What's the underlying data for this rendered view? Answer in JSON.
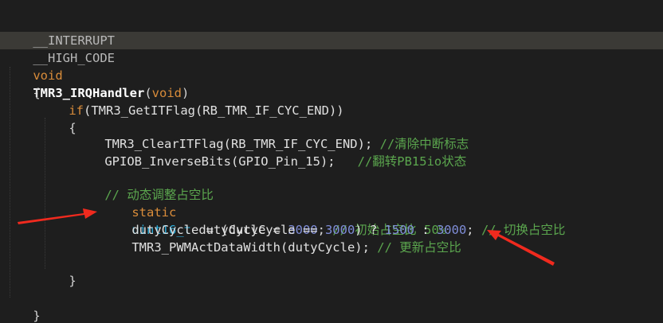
{
  "code": {
    "l1": {
      "macro": "__INTERRUPT"
    },
    "l2": {
      "macro": "__HIGH_CODE"
    },
    "l3": {
      "kw1": "void",
      "func": "TMR3_IRQHandler",
      "open": "(",
      "kw2": "void",
      "close": ")"
    },
    "l4": {
      "text": "{"
    },
    "l5": {
      "kw": "if",
      "rest": "(TMR3_GetITFlag(RB_TMR_IF_CYC_END))"
    },
    "l6": {
      "text": "{"
    },
    "l7": {
      "code": "TMR3_ClearITFlag(RB_TMR_IF_CYC_END); ",
      "comment": "//清除中断标志"
    },
    "l8": {
      "code": "GPIOB_InverseBits(GPIO_Pin_15);   ",
      "comment": "//翻转PB15io状态"
    },
    "l9": {
      "comment": "// 动态调整占空比"
    },
    "l10": {
      "kw": "static",
      "type": "uint16_t",
      "ident": " dutyCycle = ",
      "num": "3000",
      "semi": "; ",
      "comment": "// 初始占空比 50%"
    },
    "l11": {
      "a": "dutyCycle = (dutyCycle == ",
      "n1": "3000",
      "b": ") ? ",
      "n2": "1500",
      "c": " : ",
      "n3": "3000",
      "d": "; ",
      "comment": "// 切换占空比"
    },
    "l12": {
      "code": "TMR3_PWMActDataWidth(dutyCycle); ",
      "comment": "// 更新占空比"
    },
    "l13": {
      "text": "}"
    },
    "l14": {
      "text": "}"
    }
  },
  "colors": {
    "background": "#1e1e1e",
    "keyword": "#d98c3a",
    "type": "#2aa9d6",
    "number": "#7f8dd8",
    "comment": "#5ba64e",
    "arrow": "#f02a1e"
  }
}
